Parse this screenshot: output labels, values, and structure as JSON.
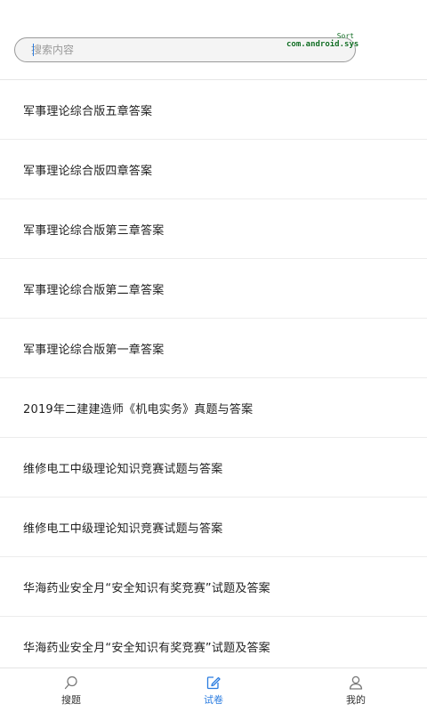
{
  "search": {
    "placeholder": "搜索内容",
    "debug_line1": "Sort",
    "debug_line2": "com.android.sys"
  },
  "items": [
    {
      "title": "军事理论综合版五章答案"
    },
    {
      "title": "军事理论综合版四章答案"
    },
    {
      "title": "军事理论综合版第三章答案"
    },
    {
      "title": "军事理论综合版第二章答案"
    },
    {
      "title": "军事理论综合版第一章答案"
    },
    {
      "title": "2019年二建建造师《机电实务》真题与答案"
    },
    {
      "title": "维修电工中级理论知识竞赛试题与答案"
    },
    {
      "title": "维修电工中级理论知识竞赛试题与答案"
    },
    {
      "title": "华海药业安全月“安全知识有奖竞赛”试题及答案"
    },
    {
      "title": "华海药业安全月“安全知识有奖竞赛”试题及答案"
    }
  ],
  "tabbar": {
    "tabs": [
      {
        "label": "搜题",
        "icon": "search-icon"
      },
      {
        "label": "试卷",
        "icon": "edit-icon",
        "active": true
      },
      {
        "label": "我的",
        "icon": "user-icon"
      }
    ],
    "active_color": "#2a7ce0",
    "inactive_color": "#666666"
  }
}
